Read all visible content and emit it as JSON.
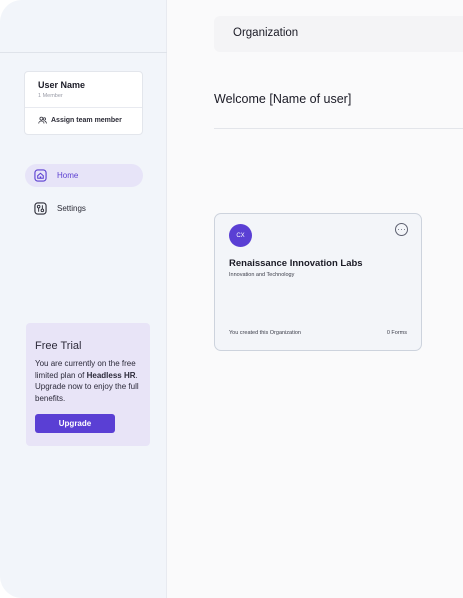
{
  "sidebar": {
    "user": {
      "name": "User Name",
      "members": "1 Member",
      "assign_label": "Assign team member"
    },
    "nav": [
      {
        "label": "Home",
        "icon": "home-icon",
        "active": true
      },
      {
        "label": "Settings",
        "icon": "settings-icon",
        "active": false
      }
    ],
    "trial": {
      "title": "Free Trial",
      "text_before": "You are currently on the free limited plan of ",
      "plan_name": "Headless HR",
      "text_after": ". Upgrade now to enjoy the full benefits.",
      "button_label": "Upgrade"
    }
  },
  "header": {
    "title": "Organization"
  },
  "main": {
    "welcome": "Welcome [Name of user]",
    "organization": {
      "initials": "CX",
      "name": "Renaissance Innovation Labs",
      "industry": "Innovation and Technology",
      "created_by": "You created this Organization",
      "forms": "0 Forms"
    }
  },
  "colors": {
    "accent": "#5a3fd4",
    "sidebar_bg": "#f2f5fa",
    "trial_bg": "#e8e4f7",
    "active_nav_bg": "#e7e4f8"
  }
}
